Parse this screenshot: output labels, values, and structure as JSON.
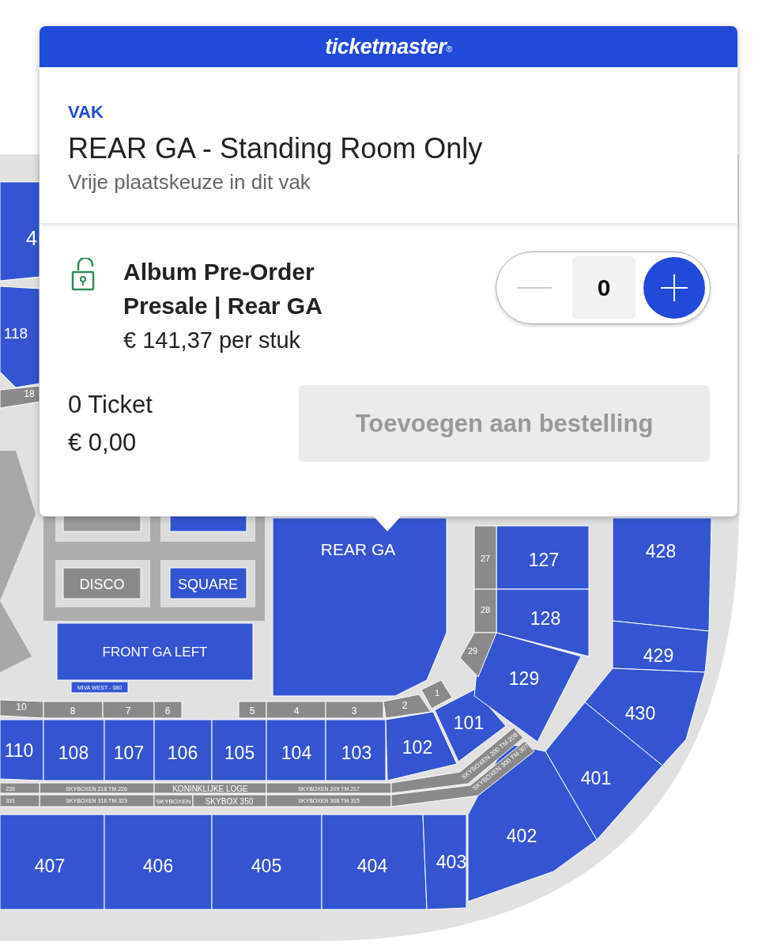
{
  "brand": {
    "name": "ticketmaster",
    "mark": "®"
  },
  "section": {
    "caption": "VAK",
    "title": "REAR GA - Standing Room Only",
    "subtitle": "Vrije plaatskeuze in dit vak"
  },
  "offer": {
    "locked": false,
    "name": "Album Pre-Order Presale | Rear GA",
    "price": "€ 141,37 per stuk",
    "quantity": "0",
    "minus_disabled": true
  },
  "summary": {
    "count": "0 Ticket",
    "total": "€ 0,00"
  },
  "add_button": {
    "label": "Toevoegen aan bestelling",
    "disabled": true
  },
  "map": {
    "areas": [
      {
        "label": "4",
        "kind": "seat"
      },
      {
        "label": "118",
        "kind": "seat"
      },
      {
        "label": "18",
        "kind": "aisle"
      },
      {
        "label": "10",
        "kind": "aisle"
      },
      {
        "label": "8",
        "kind": "aisle"
      },
      {
        "label": "7",
        "kind": "aisle"
      },
      {
        "label": "6",
        "kind": "aisle"
      },
      {
        "label": "5",
        "kind": "aisle"
      },
      {
        "label": "4",
        "kind": "aisle"
      },
      {
        "label": "3",
        "kind": "aisle"
      },
      {
        "label": "2",
        "kind": "aisle"
      },
      {
        "label": "1",
        "kind": "aisle"
      },
      {
        "label": "110",
        "kind": "seat"
      },
      {
        "label": "108",
        "kind": "seat"
      },
      {
        "label": "107",
        "kind": "seat"
      },
      {
        "label": "106",
        "kind": "seat"
      },
      {
        "label": "105",
        "kind": "seat"
      },
      {
        "label": "104",
        "kind": "seat"
      },
      {
        "label": "103",
        "kind": "seat"
      },
      {
        "label": "102",
        "kind": "seat"
      },
      {
        "label": "101",
        "kind": "seat"
      },
      {
        "label": "127",
        "kind": "seat"
      },
      {
        "label": "128",
        "kind": "seat"
      },
      {
        "label": "129",
        "kind": "seat"
      },
      {
        "label": "27",
        "kind": "aisle"
      },
      {
        "label": "28",
        "kind": "aisle"
      },
      {
        "label": "29",
        "kind": "aisle"
      },
      {
        "label": "428",
        "kind": "seat"
      },
      {
        "label": "429",
        "kind": "seat"
      },
      {
        "label": "430",
        "kind": "seat"
      },
      {
        "label": "401",
        "kind": "seat"
      },
      {
        "label": "402",
        "kind": "seat"
      },
      {
        "label": "407",
        "kind": "seat"
      },
      {
        "label": "406",
        "kind": "seat"
      },
      {
        "label": "405",
        "kind": "seat"
      },
      {
        "label": "404",
        "kind": "seat"
      },
      {
        "label": "403",
        "kind": "seat"
      },
      {
        "label": "SKYBOXEN 218 TM 226",
        "kind": "aisle"
      },
      {
        "label": "KONINKLIJKE LOGE",
        "kind": "aisle"
      },
      {
        "label": "SKYBOXEN 209 TM 217",
        "kind": "aisle"
      },
      {
        "label": "SKYBOXEN 200 TM 208",
        "kind": "aisle"
      },
      {
        "label": "SKYBOXEN 316 TM 323",
        "kind": "aisle"
      },
      {
        "label": "SKYBOXEN",
        "kind": "aisle"
      },
      {
        "label": "SKYBOX 350",
        "kind": "aisle"
      },
      {
        "label": "SKYBOXEN 308 TM 315",
        "kind": "aisle"
      },
      {
        "label": "SKYBOXEN 300 TM 307",
        "kind": "aisle"
      },
      {
        "label": "235",
        "kind": "aisle"
      },
      {
        "label": "331",
        "kind": "aisle"
      },
      {
        "label": "REAR GA",
        "kind": "seat"
      },
      {
        "label": "DISCO",
        "kind": "aisle"
      },
      {
        "label": "SQUARE",
        "kind": "seat"
      },
      {
        "label": "FRONT GA LEFT",
        "kind": "seat"
      },
      {
        "label": "MIVA WEST - 080",
        "kind": "seat"
      }
    ]
  }
}
